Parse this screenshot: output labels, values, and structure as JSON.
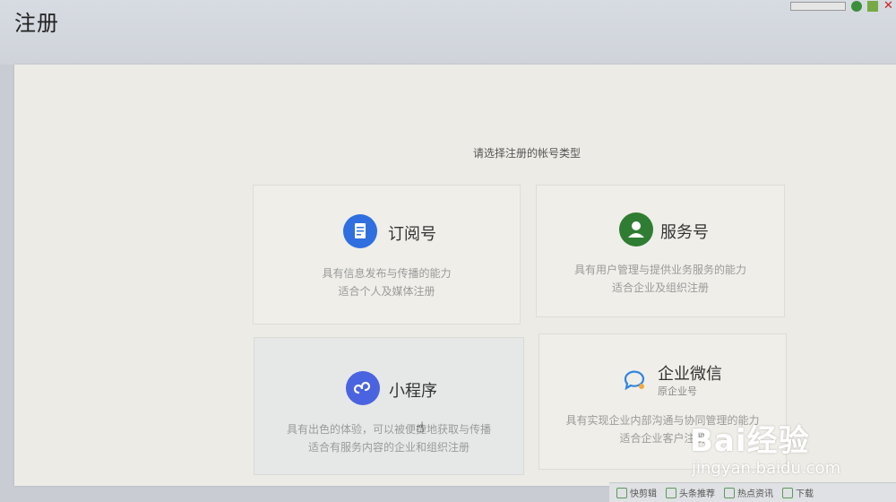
{
  "header": {
    "title": "注册"
  },
  "main": {
    "prompt": "请选择注册的帐号类型",
    "cards": [
      {
        "name": "订阅号",
        "desc1": "具有信息发布与传播的能力",
        "desc2": "适合个人及媒体注册",
        "icon": "document-icon",
        "color": "#2f6fe0"
      },
      {
        "name": "服务号",
        "desc1": "具有用户管理与提供业务服务的能力",
        "desc2": "适合企业及组织注册",
        "icon": "user-icon",
        "color": "#2e7d32"
      },
      {
        "name": "小程序",
        "desc1": "具有出色的体验，可以被便捷地获取与传播",
        "desc2": "适合有服务内容的企业和组织注册",
        "icon": "mini-program-icon",
        "color": "#4a63e0"
      },
      {
        "name": "企业微信",
        "sub": "原企业号",
        "desc1": "具有实现企业内部沟通与协同管理的能力",
        "desc2": "适合企业客户注册",
        "icon": "chat-bubble-icon",
        "color": "#2f86e0"
      }
    ]
  },
  "taskbar": {
    "items": [
      "快剪辑",
      "头条推荐",
      "热点资讯",
      "下载"
    ]
  },
  "watermark": {
    "brand": "Bai经验",
    "url": "jingyan.baidu.com"
  }
}
